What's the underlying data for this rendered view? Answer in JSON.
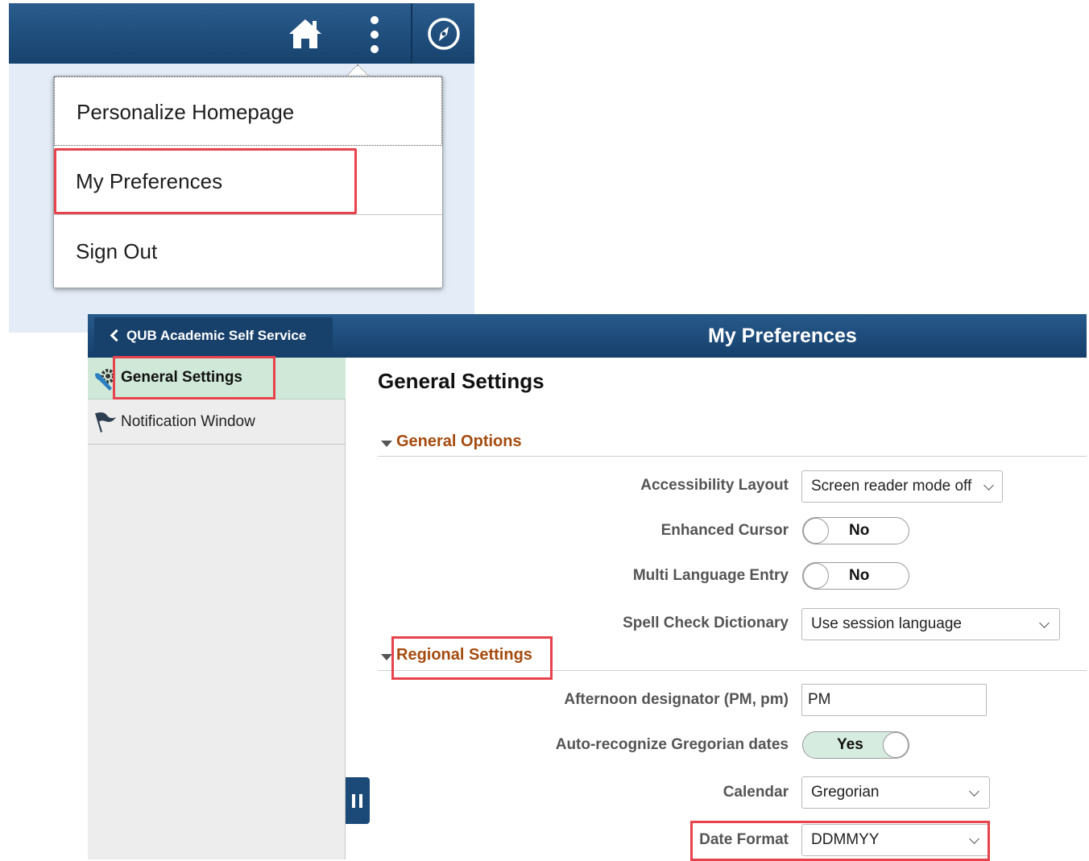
{
  "menu": {
    "items": [
      {
        "label": "Personalize Homepage"
      },
      {
        "label": "My Preferences"
      },
      {
        "label": "Sign Out"
      }
    ]
  },
  "header": {
    "back_label": "QUB Academic Self Service",
    "title": "My Preferences"
  },
  "sidebar": {
    "items": [
      {
        "label": "General Settings",
        "icon": "gear-wrench-icon",
        "selected": true
      },
      {
        "label": "Notification Window",
        "icon": "flag-icon"
      }
    ]
  },
  "content": {
    "title": "General Settings",
    "sections": [
      {
        "title": "General Options"
      },
      {
        "title": "Regional Settings"
      }
    ],
    "fields": {
      "accessibility_layout": {
        "label": "Accessibility Layout",
        "value": "Screen reader mode off"
      },
      "enhanced_cursor": {
        "label": "Enhanced Cursor",
        "value": "No"
      },
      "multi_language_entry": {
        "label": "Multi Language Entry",
        "value": "No"
      },
      "spell_check_dictionary": {
        "label": "Spell Check Dictionary",
        "value": "Use session language"
      },
      "afternoon_designator": {
        "label": "Afternoon designator (PM, pm)",
        "value": "PM"
      },
      "auto_recognize_gregorian": {
        "label": "Auto-recognize Gregorian dates",
        "value": "Yes"
      },
      "calendar": {
        "label": "Calendar",
        "value": "Gregorian"
      },
      "date_format": {
        "label": "Date Format",
        "value": "DDMMYY"
      }
    }
  },
  "colors": {
    "header_blue": "#17426e",
    "highlight_red": "#e8424c",
    "section_orange": "#a54b0f",
    "selected_green": "#cfe8d8"
  }
}
